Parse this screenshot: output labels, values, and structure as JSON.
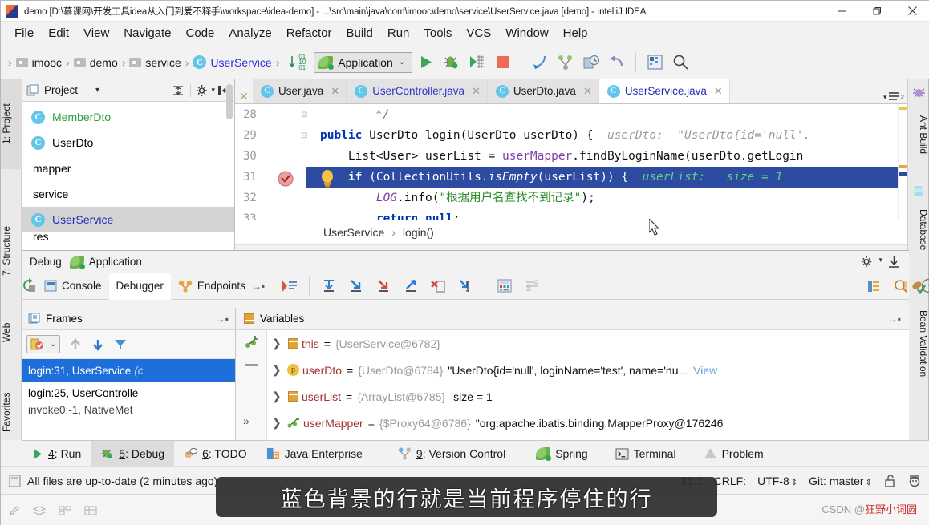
{
  "window": {
    "title": "demo [D:\\慕课网\\开发工具idea从入门到爱不释手\\workspace\\idea-demo] - ...\\src\\main\\java\\com\\imooc\\demo\\service\\UserService.java [demo] - IntelliJ IDEA",
    "minimize_label": "—",
    "maximize_label": "▢",
    "close_label": "✕"
  },
  "menu": {
    "items": [
      "File",
      "Edit",
      "View",
      "Navigate",
      "Code",
      "Analyze",
      "Refactor",
      "Build",
      "Run",
      "Tools",
      "VCS",
      "Window",
      "Help"
    ]
  },
  "navbar": {
    "breadcrumbs": [
      "imooc",
      "demo",
      "service",
      "UserService"
    ],
    "run_config": "Application",
    "caret": "⌄",
    "icons": [
      "debug-numbers-icon",
      "run-icon",
      "debug-icon",
      "run-coverage-icon",
      "stop-icon",
      "step-into-icon",
      "branch-icon",
      "time-icon",
      "rollback-icon",
      "database-icon",
      "search-icon"
    ]
  },
  "left_strip": {
    "tabs": [
      {
        "label": "1: Project",
        "selected": true
      },
      {
        "label": "7: Structure",
        "selected": false
      },
      {
        "label": "Web",
        "selected": false
      },
      {
        "label": "Favorites",
        "selected": false
      }
    ]
  },
  "right_strip": {
    "tabs": [
      "Ant Build",
      "Database",
      "Bean Validation"
    ]
  },
  "project_panel": {
    "title": "Project",
    "caret": "▾",
    "tree": [
      {
        "label": "MemberDto",
        "kind": "class",
        "color": "green",
        "selected": false
      },
      {
        "label": "UserDto",
        "kind": "class",
        "color": "black",
        "selected": false
      },
      {
        "label": "mapper",
        "kind": "folder",
        "color": "black",
        "selected": false
      },
      {
        "label": "service",
        "kind": "folder",
        "color": "black",
        "selected": false
      },
      {
        "label": "UserService",
        "kind": "class-run",
        "color": "blue",
        "selected": true
      },
      {
        "label": "res",
        "kind": "folder",
        "color": "black",
        "selected": false
      }
    ]
  },
  "editor": {
    "tabs": [
      {
        "label": "User.java",
        "active": false,
        "modified": false
      },
      {
        "label": "UserController.java",
        "active": false,
        "modified": true
      },
      {
        "label": "UserDto.java",
        "active": false,
        "modified": false
      },
      {
        "label": "UserService.java",
        "active": true,
        "modified": false
      }
    ],
    "tab_list_icon": "tab-list-icon",
    "lines": [
      {
        "num": "28",
        "text": "    */",
        "type": "comment"
      },
      {
        "num": "29",
        "text": "    public UserDto login(UserDto userDto) {",
        "hint": "userDto:  \"UserDto{id='null',",
        "type": "code"
      },
      {
        "num": "30",
        "text": "        List<User> userList = userMapper.findByLoginName(userDto.getLogin",
        "type": "code"
      },
      {
        "num": "31",
        "text": "        if (CollectionUtils.isEmpty(userList)) {",
        "hint": "userList:   size = 1",
        "type": "current"
      },
      {
        "num": "32",
        "text": "            LOG.info(\"根据用户名查找不到记录\");",
        "type": "code"
      },
      {
        "num": "33",
        "text": "            return null;",
        "type": "code"
      }
    ],
    "breadcrumb": [
      "UserService",
      "login()"
    ],
    "breadcrumb_sep": "›"
  },
  "debug": {
    "panel_title": "Debug",
    "config_name": "Application",
    "tabs": [
      {
        "label": "Console",
        "active": false,
        "icon": "console-icon"
      },
      {
        "label": "Debugger",
        "active": true,
        "icon": ""
      },
      {
        "label": "Endpoints",
        "active": false,
        "icon": "endpoints-icon"
      }
    ],
    "frames": {
      "title": "Frames",
      "rows": [
        {
          "label": "login:31, UserService",
          "suffix": "(c",
          "selected": true
        },
        {
          "label": "login:25, UserControlle",
          "suffix": "",
          "selected": false
        },
        {
          "label": "invoke0:-1, NativeMet",
          "suffix": "",
          "selected": false
        }
      ]
    },
    "variables": {
      "title": "Variables",
      "rows": [
        {
          "name": "this",
          "icon": "field-icon",
          "eq": "=",
          "ref": "{UserService@6782}",
          "value": "",
          "link": ""
        },
        {
          "name": "userDto",
          "icon": "param-icon",
          "eq": "=",
          "ref": "{UserDto@6784}",
          "value": "\"UserDto{id='null', loginName='test', name='nu",
          "ellipsis": "...",
          "link": "View"
        },
        {
          "name": "userList",
          "icon": "field-icon",
          "eq": "=",
          "ref": "{ArrayList@6785}",
          "value": "size = 1",
          "link": ""
        },
        {
          "name": "userMapper",
          "icon": "proxy-icon",
          "eq": "=",
          "ref": "{$Proxy64@6786}",
          "value": "\"org.apache.ibatis.binding.MapperProxy@176246",
          "link": ""
        }
      ]
    }
  },
  "toolwindow_bar": {
    "items": [
      {
        "num": "4",
        "label": ": Run",
        "icon": "run-icon",
        "selected": false
      },
      {
        "num": "5",
        "label": ": Debug",
        "icon": "debug-icon",
        "selected": true
      },
      {
        "num": "6",
        "label": ": TODO",
        "icon": "todo-icon",
        "selected": false
      },
      {
        "num": "",
        "label": "Java Enterprise",
        "icon": "java-ee-icon",
        "selected": false
      },
      {
        "num": "9",
        "label": ": Version Control",
        "icon": "vcs-icon",
        "selected": false
      },
      {
        "num": "",
        "label": "Spring",
        "icon": "spring-icon",
        "selected": false
      },
      {
        "num": "",
        "label": "Terminal",
        "icon": "terminal-icon",
        "selected": false
      },
      {
        "num": "",
        "label": "Problem",
        "icon": "problems-icon",
        "selected": false
      }
    ]
  },
  "statusbar": {
    "message": "All files are up-to-date (2 minutes ago)",
    "position": "31:1",
    "line_sep": "CRLF:",
    "encoding": "UTF-8",
    "branch": "Git: master",
    "spinner": "⇕",
    "lock_icon": "unlock-icon",
    "inspector_icon": "inspector-icon"
  },
  "subtitle": {
    "text": "蓝色背景的行就是当前程序停住的行"
  },
  "watermark": {
    "prefix": "CSDN @",
    "text": "狂野小词圆"
  },
  "colors": {
    "accent_blue": "#2d4ba0",
    "selection_blue": "#1e6fd9",
    "green_string": "#2a8a2a",
    "keyword_blue": "#0033b3",
    "class_icon": "#63c6e8"
  }
}
